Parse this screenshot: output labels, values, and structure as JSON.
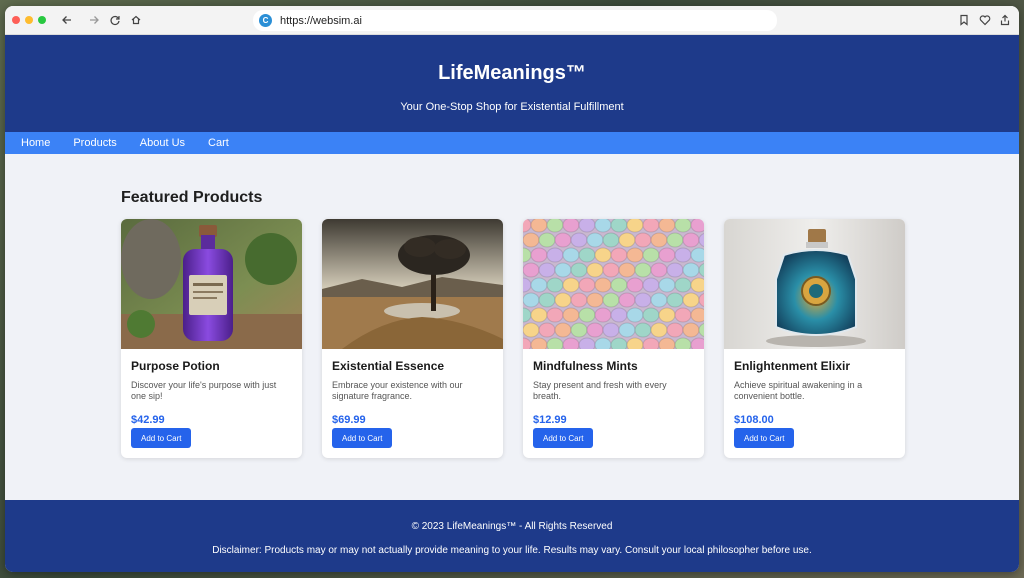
{
  "browser": {
    "url": "https://websim.ai",
    "site_icon_letter": "C",
    "back_icon": "arrow-left-icon",
    "forward_icon": "arrow-right-icon",
    "reload_icon": "reload-icon",
    "home_icon": "home-icon",
    "bookmark_icon": "bookmark-icon",
    "heart_icon": "heart-icon",
    "share_icon": "share-icon"
  },
  "header": {
    "title": "LifeMeanings™",
    "tagline": "Your One-Stop Shop for Existential Fulfillment"
  },
  "nav": {
    "items": [
      "Home",
      "Products",
      "About Us",
      "Cart"
    ]
  },
  "main": {
    "section_title": "Featured Products",
    "products": [
      {
        "name": "Purpose Potion",
        "description": "Discover your life's purpose with just one sip!",
        "price": "$42.99",
        "button": "Add to Cart",
        "image": "purple-potion-bottle"
      },
      {
        "name": "Existential Essence",
        "description": "Embrace your existence with our signature fragrance.",
        "price": "$69.99",
        "button": "Add to Cart",
        "image": "lone-tree-landscape"
      },
      {
        "name": "Mindfulness Mints",
        "description": "Stay present and fresh with every breath.",
        "price": "$12.99",
        "button": "Add to Cart",
        "image": "pastel-mints"
      },
      {
        "name": "Enlightenment Elixir",
        "description": "Achieve spiritual awakening in a convenient bottle.",
        "price": "$108.00",
        "button": "Add to Cart",
        "image": "blue-elixir-bottle"
      }
    ]
  },
  "footer": {
    "copyright": "© 2023 LifeMeanings™ - All Rights Reserved",
    "disclaimer": "Disclaimer: Products may or may not actually provide meaning to your life. Results may vary. Consult your local philosopher before use."
  },
  "colors": {
    "header_bg": "#1e3a8a",
    "nav_bg": "#3b82f6",
    "accent": "#2563eb",
    "page_bg": "#f0f2f7"
  }
}
